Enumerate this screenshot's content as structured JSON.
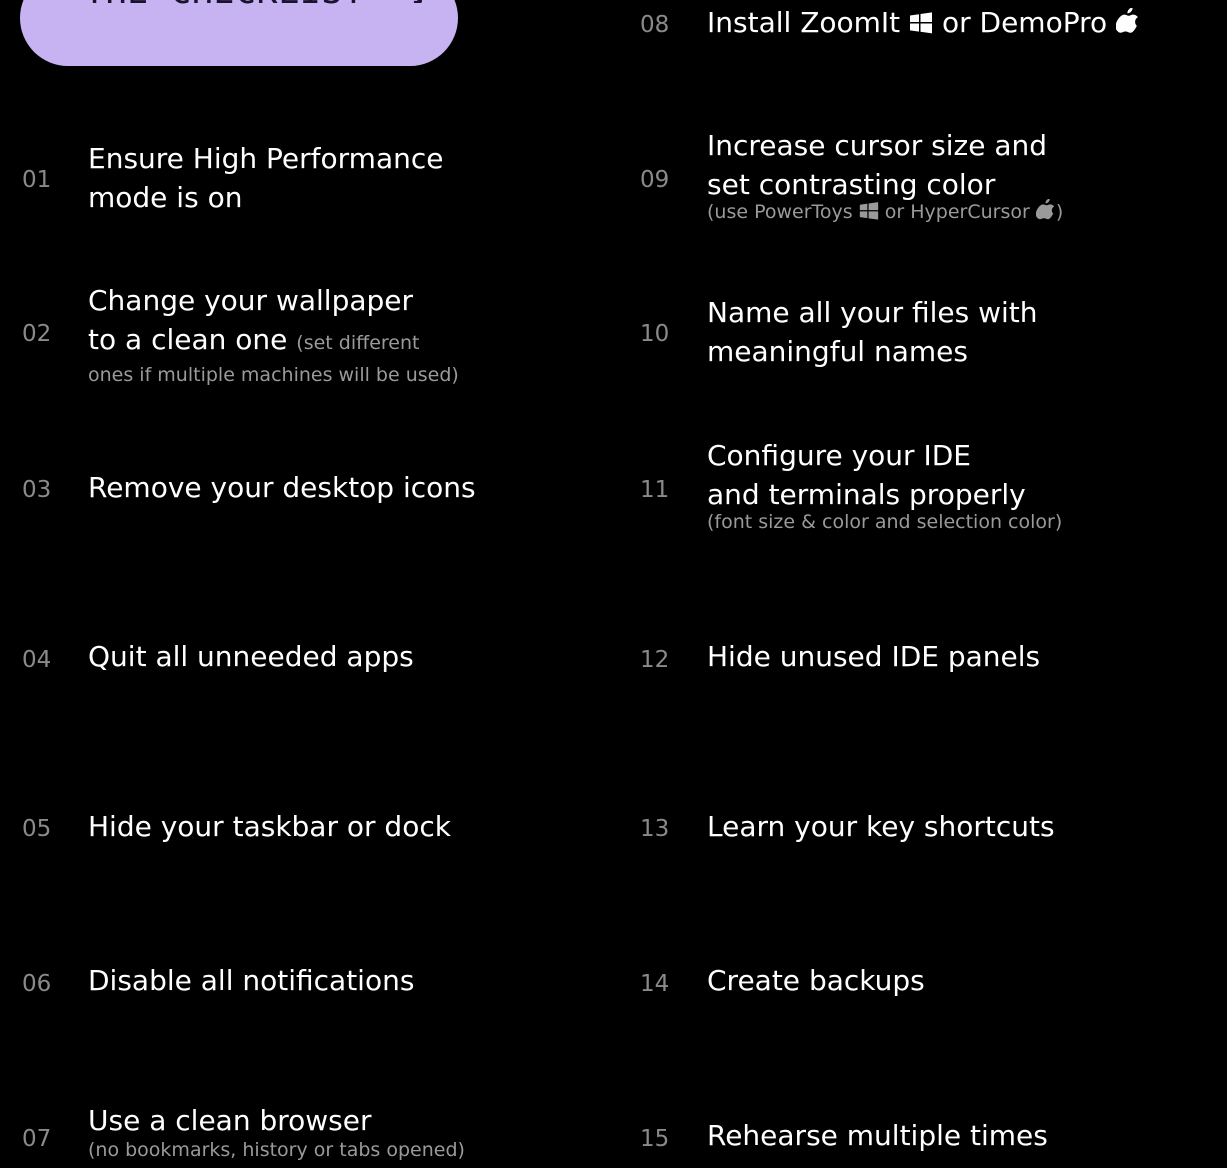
{
  "header": {
    "title": "THE CHECKLIST",
    "arrow": "↘"
  },
  "items": [
    {
      "num": "01",
      "line1": "Ensure High Performance",
      "line2": "mode is on"
    },
    {
      "num": "02",
      "line1": "Change your wallpaper",
      "line2": "to a clean one",
      "inline_note": "(set different",
      "note": "ones if multiple machines will be used)"
    },
    {
      "num": "03",
      "line1": "Remove your desktop icons"
    },
    {
      "num": "04",
      "line1": "Quit all unneeded apps"
    },
    {
      "num": "05",
      "line1": "Hide your taskbar or dock"
    },
    {
      "num": "06",
      "line1": "Disable all notifications"
    },
    {
      "num": "07",
      "line1": "Use a clean browser",
      "note": "(no bookmarks, history or tabs opened)"
    },
    {
      "num": "08",
      "line1_a": "Install ZoomIt",
      "line1_b": "or DemoPro"
    },
    {
      "num": "09",
      "line1": "Increase cursor size and",
      "line2": "set contrasting color",
      "note_a": "(use PowerToys",
      "note_b": "or HyperCursor",
      "note_c": ")"
    },
    {
      "num": "10",
      "line1": "Name all your files with",
      "line2": "meaningful names"
    },
    {
      "num": "11",
      "line1": "Configure your IDE",
      "line2": "and terminals properly",
      "note": "(font size & color and selection color)"
    },
    {
      "num": "12",
      "line1": "Hide unused IDE panels"
    },
    {
      "num": "13",
      "line1": "Learn your key shortcuts"
    },
    {
      "num": "14",
      "line1": "Create backups"
    },
    {
      "num": "15",
      "line1": "Rehearse multiple times"
    }
  ],
  "icons": {
    "windows": "windows-icon",
    "apple": "apple-icon"
  },
  "colors": {
    "background": "#000000",
    "pill": "#c7b3f1",
    "number": "#8a8a8a",
    "note": "#9a9a9a"
  }
}
